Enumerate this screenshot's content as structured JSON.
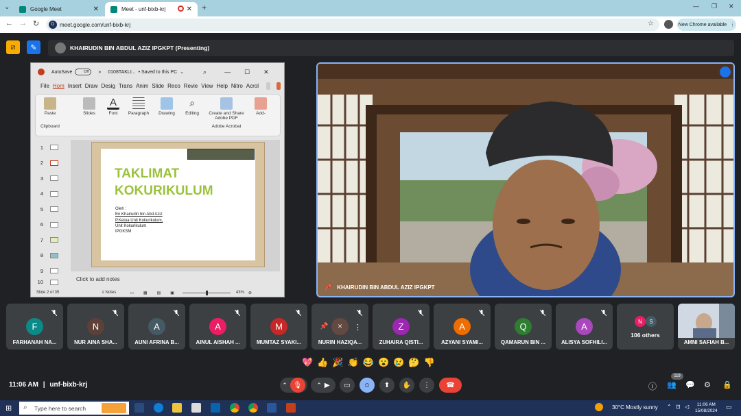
{
  "browser": {
    "tabs": [
      {
        "title": "Google Meet",
        "active": false
      },
      {
        "title": "Meet - unf-bixb-krj",
        "active": true
      }
    ],
    "url": "meet.google.com/unf-bixb-krj",
    "new_chrome_label": "New Chrome available"
  },
  "presenting": {
    "label": "KHAIRUDIN BIN ABDUL AZIZ IPGKPT (Presenting)"
  },
  "powerpoint": {
    "autosave_label": "AutoSave",
    "autosave_state": "Off",
    "filename": "0108TAKLI...",
    "save_status": "• Saved to this PC",
    "menu": [
      "File",
      "Hom",
      "Insert",
      "Draw",
      "Desig",
      "Trans",
      "Anim",
      "Slide",
      "Reco",
      "Revie",
      "View",
      "Help",
      "Nitro",
      "Acrol"
    ],
    "ribbon_groups": [
      {
        "label": "Paste",
        "sub": "Clipboard"
      },
      {
        "label": "Slides"
      },
      {
        "label": "Font"
      },
      {
        "label": "Paragraph"
      },
      {
        "label": "Drawing"
      },
      {
        "label": "Editing"
      },
      {
        "label": "Create and Share Adobe PDF",
        "sub": "Adobe Acrobat"
      },
      {
        "label": "Add-"
      }
    ],
    "thumbnails": [
      "1",
      "2",
      "3",
      "4",
      "5",
      "6",
      "7",
      "8",
      "9",
      "10"
    ],
    "slide": {
      "title_line1": "TAKLIMAT",
      "title_line2": "KOKURIKULUM",
      "body": [
        "Oleh :",
        "En.Khairudin bin Abd Aziz",
        "P.Ketua Unit Kokurikulum,",
        "Unit Kokurikulum",
        "IPGKSM"
      ]
    },
    "notes_placeholder": "Click to add notes",
    "status_slide": "Slide 2 of 35",
    "notes_btn": "Notes",
    "zoom": "43%"
  },
  "video": {
    "name": "KHAIRUDIN BIN ABDUL AZIZ IPGKPT"
  },
  "participants": [
    {
      "initial": "F",
      "name": "FARHANAH NA...",
      "color": "#0b8a8a"
    },
    {
      "initial": "N",
      "name": "NUR AINA SHA...",
      "color": "#5d4037"
    },
    {
      "initial": "A",
      "name": "AUNI AFRINA B...",
      "color": "#455a64"
    },
    {
      "initial": "A",
      "name": "AINUL AISHAH ...",
      "color": "#e91e63"
    },
    {
      "initial": "M",
      "name": "MUMTAZ SYAKI...",
      "color": "#c62828"
    },
    {
      "initial": "",
      "name": "NURIN HAZIQA...",
      "color": "#6d4c41"
    },
    {
      "initial": "Z",
      "name": "ZUHAIRA QISTI...",
      "color": "#9c27b0"
    },
    {
      "initial": "A",
      "name": "AZYANI SYAMI...",
      "color": "#ef6c00"
    },
    {
      "initial": "Q",
      "name": "QAMARUN BIN ...",
      "color": "#2e7d32"
    },
    {
      "initial": "A",
      "name": "ALISYA SOFHILI...",
      "color": "#ab47bc"
    }
  ],
  "others": {
    "label": "106 others",
    "initials": [
      "N",
      "S"
    ]
  },
  "last_tile": {
    "name": "AMNI SAFIAH B..."
  },
  "reactions": [
    "💖",
    "👍",
    "🎉",
    "👏",
    "😂",
    "😮",
    "😢",
    "🤔",
    "👎"
  ],
  "meeting": {
    "time": "11:06 AM",
    "separator": "|",
    "code": "unf-bixb-krj"
  },
  "people_count": "119",
  "taskbar": {
    "search_placeholder": "Type here to search",
    "weather": "30°C  Mostly sunny",
    "time": "11:06 AM",
    "date": "15/08/2024"
  },
  "colors": {
    "end_call": "#ea4335",
    "accent": "#8ab4f8",
    "mic_off": "#ea4335"
  }
}
